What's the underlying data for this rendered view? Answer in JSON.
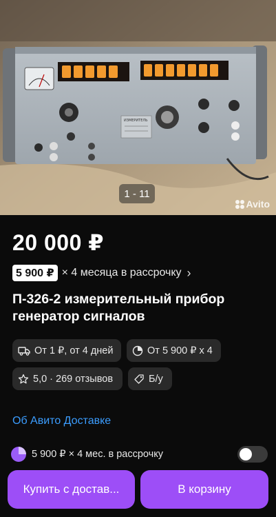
{
  "gallery": {
    "counter": "1 - 11",
    "watermark": "Avito",
    "photo_subject": "ИЗМЕРИТЕЛЬ"
  },
  "listing": {
    "price": "20 000 ₽",
    "installment_amount": "5 900 ₽",
    "installment_text": "× 4 месяца в рассрочку",
    "title": "П-326-2 измерительный прибор генератор сигналов"
  },
  "chips": [
    {
      "icon": "truck-icon",
      "label": "От 1 ₽, от 4 дней"
    },
    {
      "icon": "installment-pie-icon",
      "label": "От 5 900 ₽ х 4"
    },
    {
      "icon": "star-icon",
      "label": "5,0 · 269 отзывов"
    },
    {
      "icon": "tag-icon",
      "label": "Б/у"
    }
  ],
  "links": {
    "delivery": "Об Авито Доставке"
  },
  "installment_option": {
    "text": "5 900 ₽ × 4 мес. в рассрочку",
    "enabled": false
  },
  "actions": {
    "buy": "Купить с достав...",
    "cart": "В корзину"
  },
  "colors": {
    "accent": "#9d4ef7",
    "link": "#3b9dff",
    "background": "#0b0b0b",
    "chip": "#2a2a2a"
  }
}
